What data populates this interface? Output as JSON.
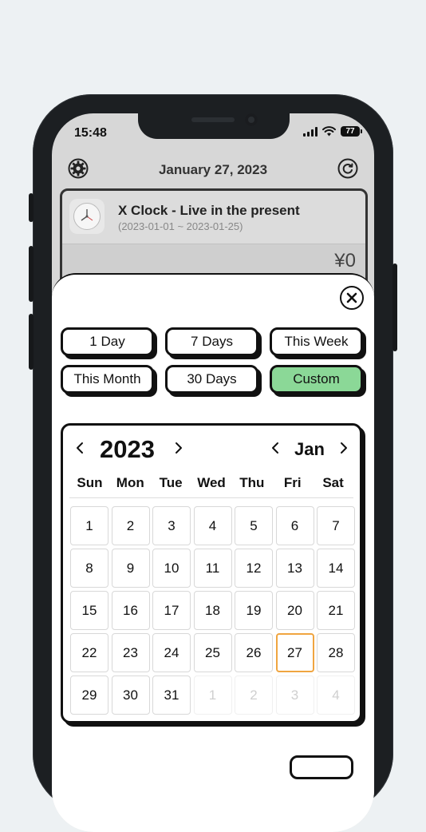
{
  "status_bar": {
    "time": "15:48",
    "battery": "77"
  },
  "header": {
    "title": "January 27, 2023"
  },
  "entry": {
    "title": "X Clock - Live in the present",
    "range": "(2023-01-01 ~ 2023-01-25)",
    "amount": "¥0"
  },
  "ranges": [
    {
      "label": "1 Day",
      "active": false
    },
    {
      "label": "7 Days",
      "active": false
    },
    {
      "label": "This Week",
      "active": false
    },
    {
      "label": "This Month",
      "active": false
    },
    {
      "label": "30 Days",
      "active": false
    },
    {
      "label": "Custom",
      "active": true
    }
  ],
  "calendar": {
    "year": "2023",
    "month": "Jan",
    "weekdays": [
      "Sun",
      "Mon",
      "Tue",
      "Wed",
      "Thu",
      "Fri",
      "Sat"
    ],
    "days": [
      {
        "d": "1"
      },
      {
        "d": "2"
      },
      {
        "d": "3"
      },
      {
        "d": "4"
      },
      {
        "d": "5"
      },
      {
        "d": "6"
      },
      {
        "d": "7"
      },
      {
        "d": "8"
      },
      {
        "d": "9"
      },
      {
        "d": "10"
      },
      {
        "d": "11"
      },
      {
        "d": "12"
      },
      {
        "d": "13"
      },
      {
        "d": "14"
      },
      {
        "d": "15"
      },
      {
        "d": "16"
      },
      {
        "d": "17"
      },
      {
        "d": "18"
      },
      {
        "d": "19"
      },
      {
        "d": "20"
      },
      {
        "d": "21"
      },
      {
        "d": "22"
      },
      {
        "d": "23"
      },
      {
        "d": "24"
      },
      {
        "d": "25"
      },
      {
        "d": "26"
      },
      {
        "d": "27",
        "today": true
      },
      {
        "d": "28"
      },
      {
        "d": "29"
      },
      {
        "d": "30"
      },
      {
        "d": "31"
      },
      {
        "d": "1",
        "muted": true
      },
      {
        "d": "2",
        "muted": true
      },
      {
        "d": "3",
        "muted": true
      },
      {
        "d": "4",
        "muted": true
      }
    ]
  },
  "colors": {
    "active_range": "#8bd897",
    "today_outline": "#f0a540",
    "ink": "#111111"
  },
  "icons": {
    "settings": "gear-icon",
    "refresh": "refresh-icon",
    "close": "close-icon",
    "prev": "chevron-left-icon",
    "next": "chevron-right-icon"
  }
}
